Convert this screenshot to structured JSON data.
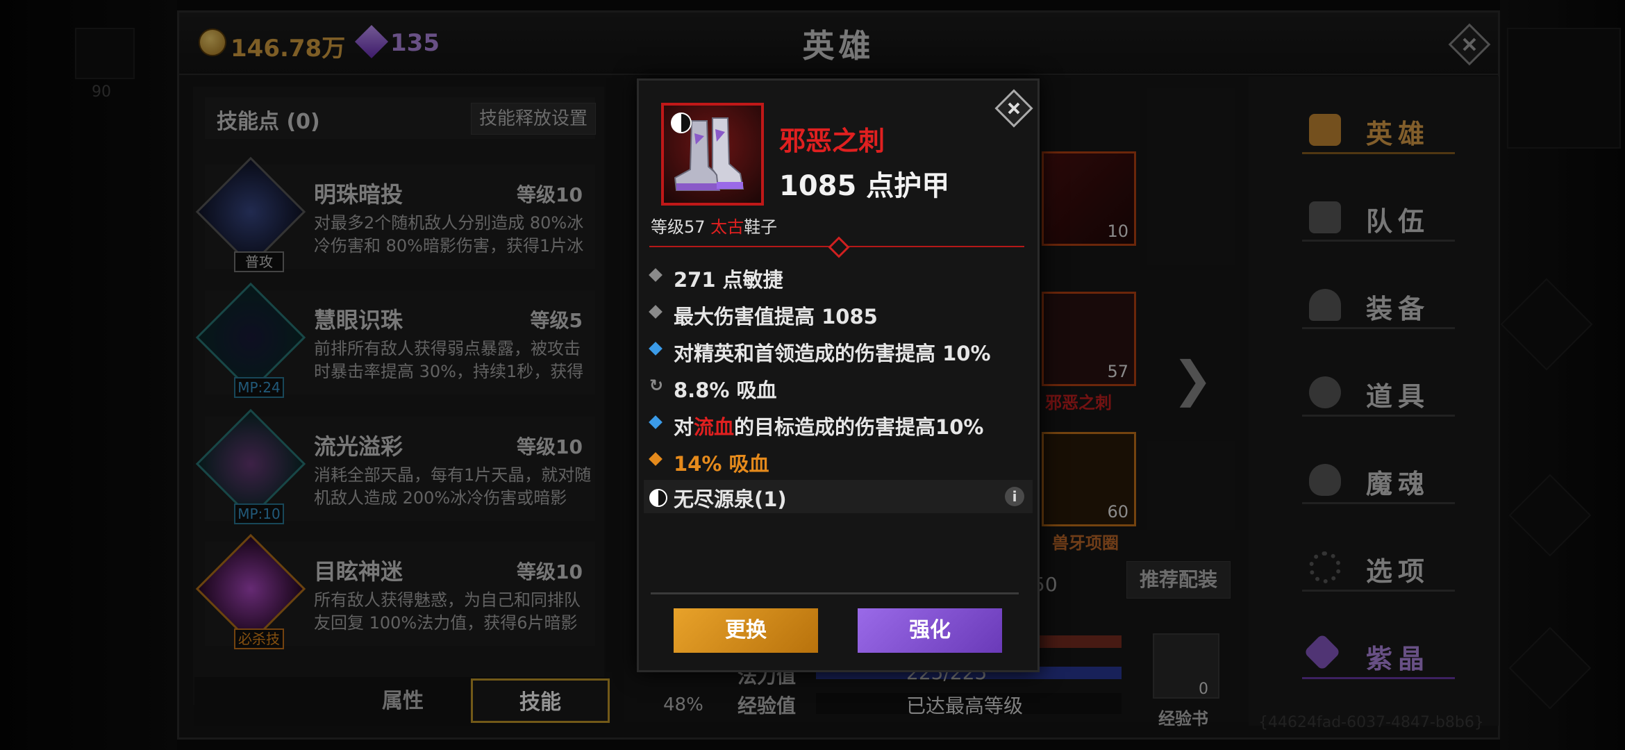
{
  "topbar": {
    "gold": "146.78万",
    "gems": "135",
    "title": "英雄"
  },
  "skills_panel": {
    "skill_points": "技能点 (0)",
    "release_settings": "技能释放设置",
    "skills": [
      {
        "name": "明珠暗投",
        "level": "等级10",
        "desc": "对最多2个随机敌人分别造成 80%冰冷伤害和 80%暗影伤害，获得1片冰",
        "tag": "普攻"
      },
      {
        "name": "慧眼识珠",
        "level": "等级5",
        "desc": "前排所有敌人获得弱点暴露，被攻击时暴击率提高 30%，持续1秒，获得",
        "tag": "MP:24"
      },
      {
        "name": "流光溢彩",
        "level": "等级10",
        "desc": "消耗全部天晶，每有1片天晶，就对随机敌人造成 200%冰冷伤害或暗影",
        "tag": "MP:10"
      },
      {
        "name": "目眩神迷",
        "level": "等级10",
        "desc": "所有敌人获得魅惑，为自己和同排队友回复 100%法力值，获得6片暗影",
        "tag": "必杀技"
      }
    ],
    "tabs": {
      "attributes": "属性",
      "skills": "技能"
    }
  },
  "hero_panel": {
    "helm_level": "10",
    "boots_level": "57",
    "boots_name": "邪恶之刺",
    "neck_level": "60",
    "neck_name": "兽牙项圈",
    "recommend": "推荐配装",
    "partial_value": "50",
    "mp_label": "法力值",
    "mp_value": "225/225",
    "exp_label": "经验值",
    "exp_value": "已达最高等级",
    "percent": "48%",
    "exp_book_label": "经验书",
    "exp_book_count": "0"
  },
  "right_nav": {
    "items": [
      "英雄",
      "队伍",
      "装备",
      "道具",
      "魔魂",
      "选项",
      "紫晶"
    ],
    "uuid": "{44624fad-6037-4847-b8b6}"
  },
  "popup": {
    "item_name": "邪恶之刺",
    "armor": "1085 点护甲",
    "meta_prefix": "等级57 ",
    "tier": "太古",
    "slot": "鞋子",
    "stats": [
      "271 点敏捷",
      "最大伤害值提高 1085",
      "对精英和首领造成的伤害提高 10%",
      "8.8% 吸血",
      "14% 吸血"
    ],
    "stat_bleed_prefix": "对",
    "stat_bleed_red": "流血",
    "stat_bleed_suffix": "的目标造成的伤害提高10%",
    "set_name": "无尽源泉(1)",
    "info_icon": "i",
    "btn_replace": "更换",
    "btn_enhance": "强化"
  },
  "colors": {
    "legendary_red": "#e02020",
    "gold": "#d9a243",
    "purple": "#b48ae6",
    "orange": "#e58a1c",
    "blue": "#3b9be8"
  }
}
